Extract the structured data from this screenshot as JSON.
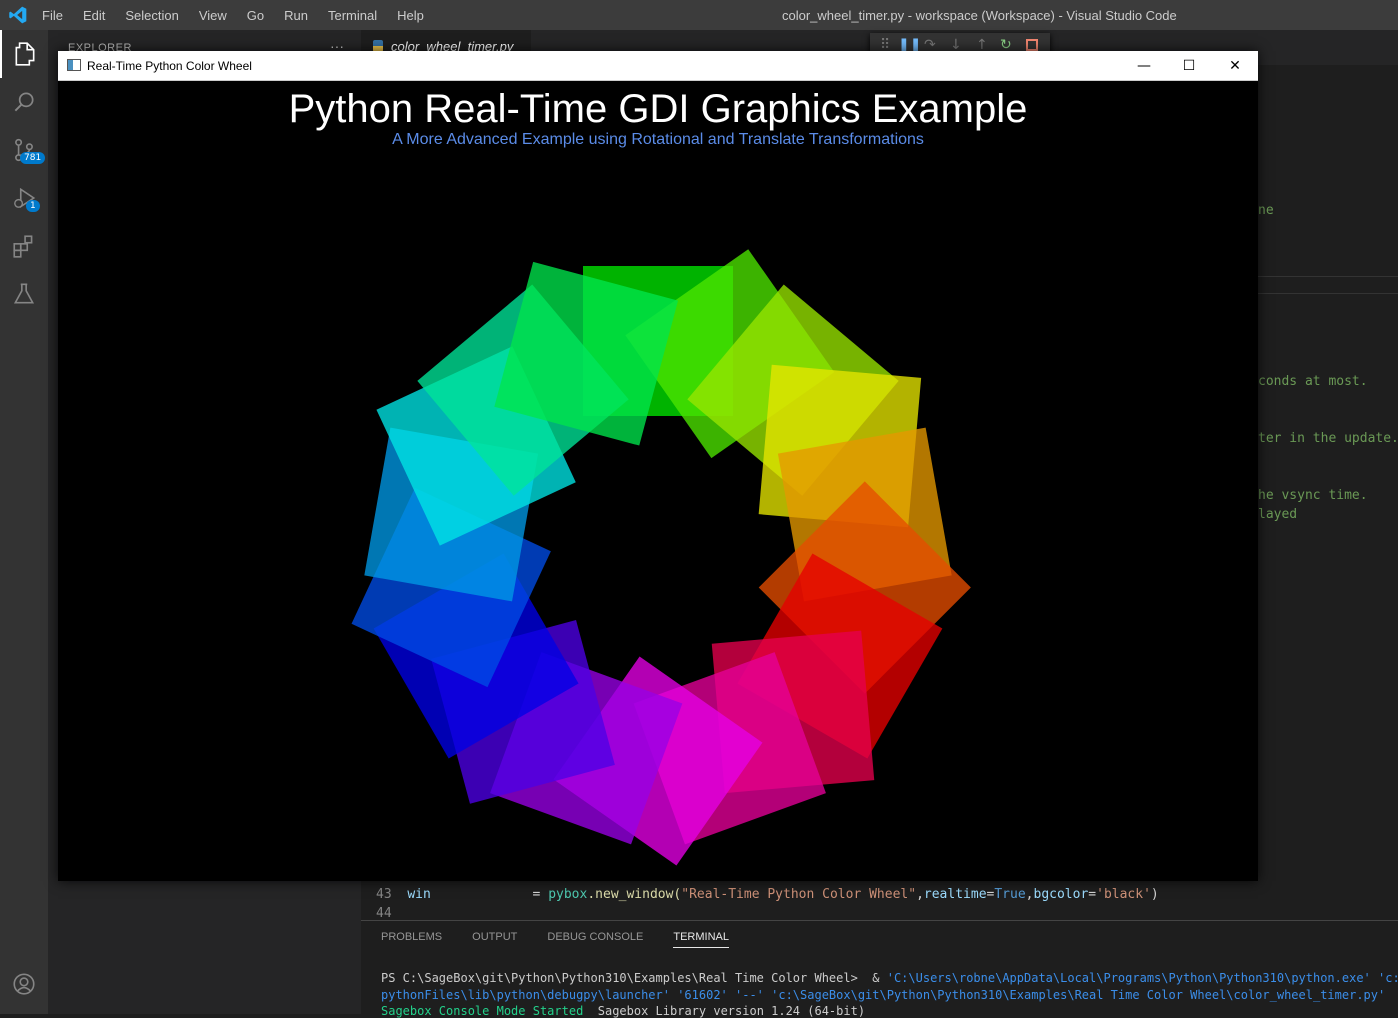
{
  "vscode": {
    "menu": [
      "File",
      "Edit",
      "Selection",
      "View",
      "Go",
      "Run",
      "Terminal",
      "Help"
    ],
    "window_title": "color_wheel_timer.py - workspace (Workspace) - Visual Studio Code",
    "source_control_badge": "781",
    "debug_badge": "1",
    "sidebar_title": "EXPLORER",
    "sidebar_more": "···",
    "tab_label": "color_wheel_timer.py",
    "tab_close": "✕",
    "code_fragments": [
      "ne",
      "conds at most.",
      "ter in the update.",
      "he vsync time.",
      "layed"
    ],
    "code_line_43_num": "43",
    "code_line_44_num": "44",
    "code_line_43": {
      "var": "win",
      "eq": "= ",
      "module": "pybox",
      "func": ".new_window(",
      "str1": "\"Real-Time Python Color Wheel\"",
      "comma1": ",",
      "kw1": "realtime",
      "eq1": "=",
      "val1": "True",
      "comma2": ",",
      "kw2": "bgcolor",
      "eq2": "=",
      "str2": "'black'",
      "close": ")"
    },
    "panel_tabs": [
      "PROBLEMS",
      "OUTPUT",
      "DEBUG CONSOLE",
      "TERMINAL"
    ],
    "terminal": {
      "prompt": "PS C:\\SageBox\\git\\Python\\Python310\\Examples\\Real Time Color Wheel>  & ",
      "exe_path": "'C:\\Users\\robne\\AppData\\Local\\Programs\\Python\\Python310\\python.exe' 'c:\\User",
      "line2": "pythonFiles\\lib\\python\\debugpy\\launcher' '61602' '--' 'c:\\SageBox\\git\\Python\\Python310\\Examples\\Real Time Color Wheel\\color_wheel_timer.py'",
      "line3_a": "Sagebox Console Mode Started",
      "line3_b": "  Sagebox Library version 1.24 (64-bit)"
    }
  },
  "app": {
    "window_title": "Real-Time Python Color Wheel",
    "heading": "Python Real-Time GDI Graphics Example",
    "subheading": "A More Advanced Example using Rotational and Translate Transformations",
    "minimize": "—",
    "maximize": "☐",
    "close": "✕"
  },
  "wheel": {
    "count": 18,
    "opacity": 0.78
  }
}
